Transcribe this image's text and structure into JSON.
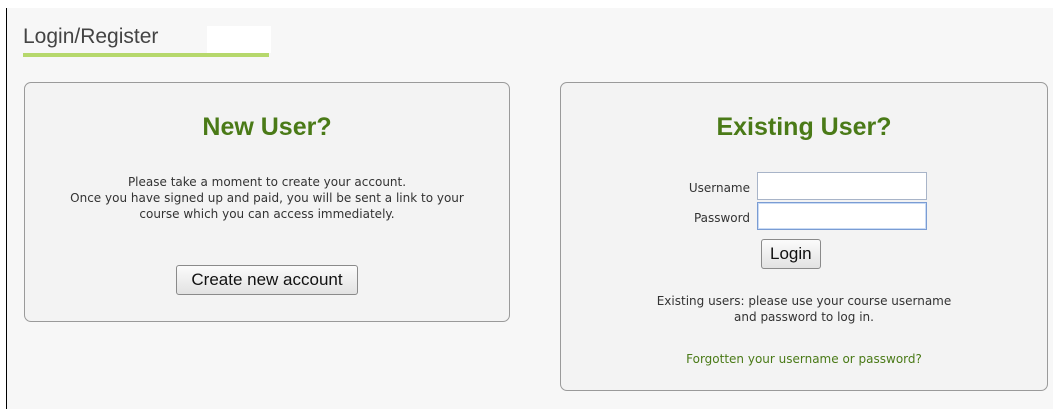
{
  "page": {
    "title": "Login/Register"
  },
  "new_user": {
    "heading": "New User?",
    "blurb_lines": [
      "Please take a moment to create your account.",
      "Once you have signed up and paid, you will be sent a link to your",
      "course which you can access immediately."
    ],
    "create_button_label": "Create new account"
  },
  "existing_user": {
    "heading": "Existing User?",
    "username_label": "Username",
    "username_value": "",
    "password_label": "Password",
    "password_value": "",
    "login_button_label": "Login",
    "help_lines": [
      "Existing users: please use your course username",
      "and password to log in."
    ],
    "forgot_link": "Forgotten your username or password?"
  },
  "colors": {
    "heading_green": "#4a7a17",
    "underline_green": "#b6d86c",
    "panel_border": "#9a9a9a",
    "background": "#f7f7f7"
  }
}
